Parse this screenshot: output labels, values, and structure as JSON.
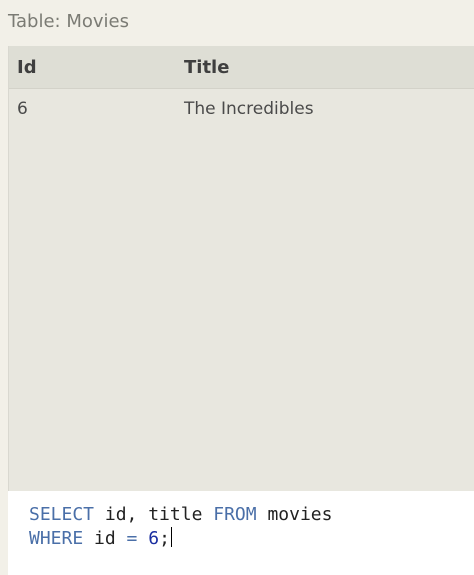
{
  "table": {
    "caption": "Table: Movies",
    "columns": [
      "Id",
      "Title"
    ],
    "rows": [
      {
        "id": "6",
        "title": "The Incredibles"
      }
    ]
  },
  "editor": {
    "line1": {
      "kw1": "SELECT",
      "text1": " id, title ",
      "kw2": "FROM",
      "text2": " movies"
    },
    "line2": {
      "kw1": "WHERE",
      "text1": " id ",
      "op": "=",
      "space": " ",
      "num": "6",
      "end": ";"
    }
  }
}
